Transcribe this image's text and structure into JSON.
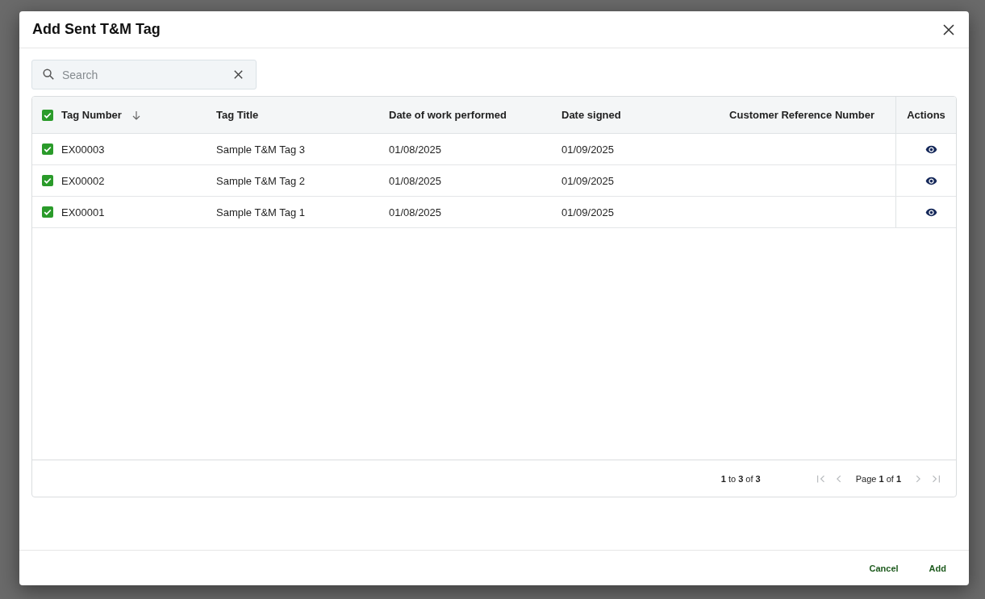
{
  "dialog": {
    "title": "Add Sent T&M Tag"
  },
  "search": {
    "placeholder": "Search"
  },
  "table": {
    "select_all": {
      "checked": true
    },
    "columns": [
      {
        "label": "Tag Number",
        "kind": "text",
        "sorted_descending": true
      },
      {
        "label": "Tag Title",
        "kind": "text"
      },
      {
        "label": "Date of work performed",
        "kind": "text"
      },
      {
        "label": "Date signed",
        "kind": "text"
      },
      {
        "label": "Customer Reference Number",
        "kind": "number"
      },
      {
        "label": "Actions",
        "kind": "actions"
      }
    ],
    "rows": [
      {
        "checked": true,
        "cells": [
          "EX00003",
          "Sample T&M Tag 3",
          "01/08/2025",
          "01/09/2025"
        ]
      },
      {
        "checked": true,
        "cells": [
          "EX00002",
          "Sample T&M Tag 2",
          "01/08/2025",
          "01/09/2025"
        ]
      },
      {
        "checked": true,
        "cells": [
          "EX00001",
          "Sample T&M Tag 1",
          "01/08/2025",
          "01/09/2025"
        ]
      }
    ],
    "pagination": {
      "summary": "**1** to **3** of **3**",
      "page_label": "Page **1** of **1**",
      "nav_buttons": [
        {
          "kind": "first",
          "disabled": true
        },
        {
          "kind": "previous",
          "disabled": true
        },
        {
          "kind": "next",
          "disabled": true
        },
        {
          "kind": "last",
          "disabled": true
        }
      ]
    }
  },
  "buttons": [
    "Cancel",
    "Add"
  ]
}
